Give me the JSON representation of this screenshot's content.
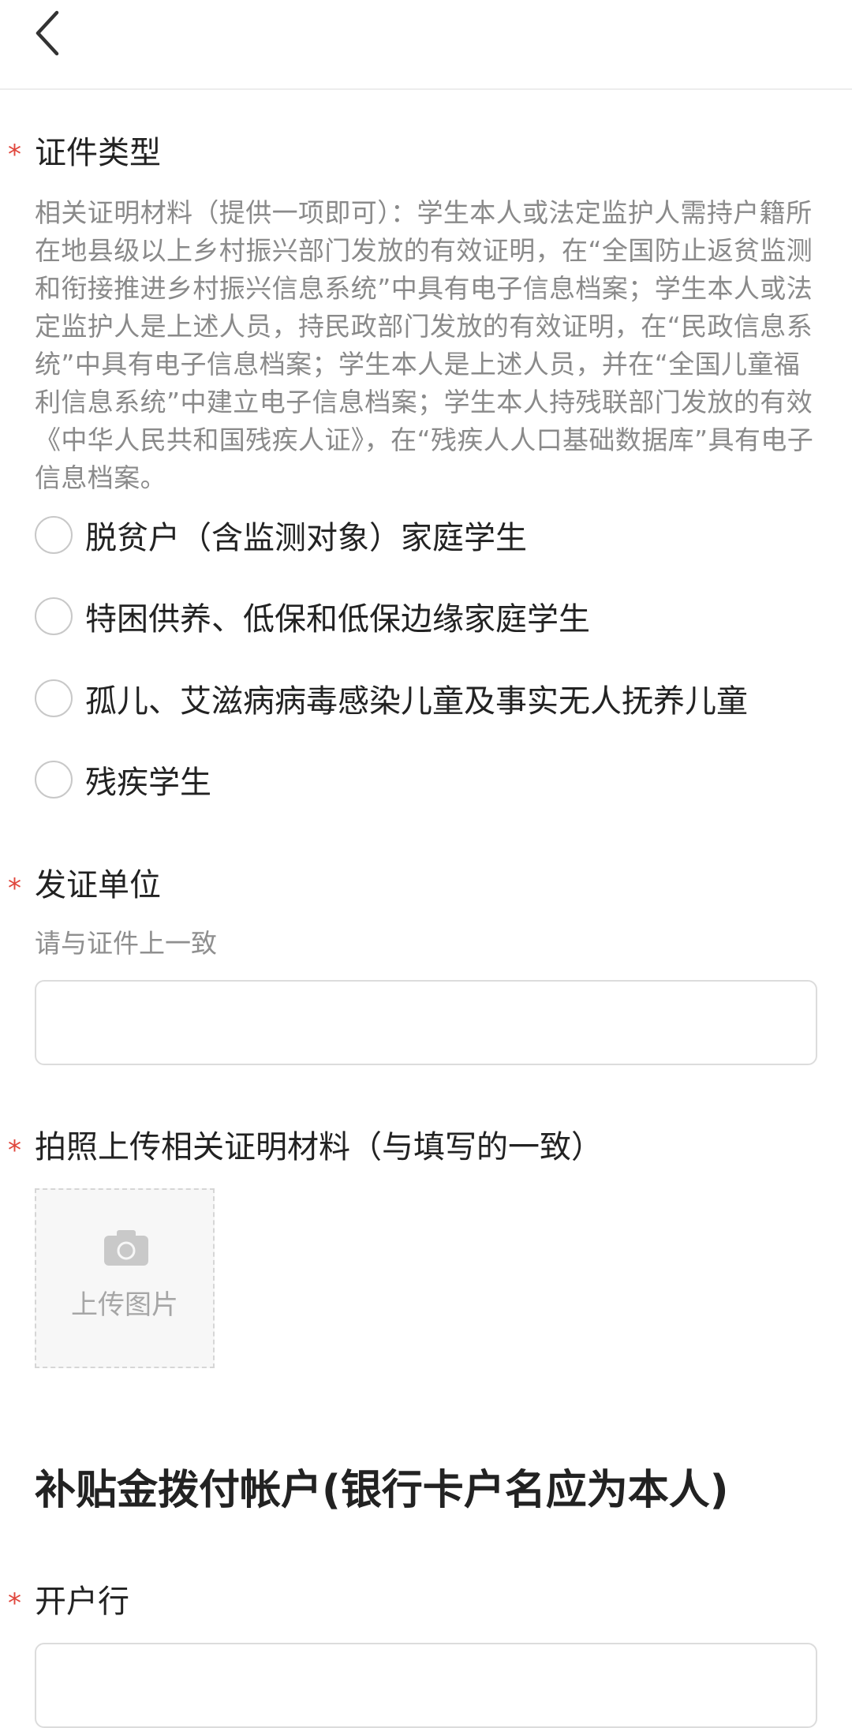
{
  "nav": {
    "back_icon": "chevron-left-icon"
  },
  "cert_type": {
    "required_mark": "*",
    "label": "证件类型",
    "help": "相关证明材料（提供一项即可）：学生本人或法定监护人需持户籍所在地县级以上乡村振兴部门发放的有效证明，在“全国防止返贫监测和衔接推进乡村振兴信息系统”中具有电子信息档案；学生本人或法定监护人是上述人员，持民政部门发放的有效证明，在“民政信息系统”中具有电子信息档案；学生本人是上述人员，并在“全国儿童福利信息系统”中建立电子信息档案；学生本人持残联部门发放的有效《中华人民共和国残疾人证》，在“残疾人人口基础数据库”具有电子信息档案。",
    "options": [
      {
        "label": "脱贫户（含监测对象）家庭学生"
      },
      {
        "label": "特困供养、低保和低保边缘家庭学生"
      },
      {
        "label": "孤儿、艾滋病病毒感染儿童及事实无人抚养儿童"
      },
      {
        "label": "残疾学生"
      }
    ]
  },
  "issuer": {
    "required_mark": "*",
    "label": "发证单位",
    "hint": "请与证件上一致",
    "value": ""
  },
  "photo": {
    "required_mark": "*",
    "label": "拍照上传相关证明材料（与填写的一致）",
    "upload_label": "上传图片",
    "icon": "camera-icon"
  },
  "account_section": {
    "heading": "补贴金拨付帐户(银行卡户名应为本人)"
  },
  "bank": {
    "required_mark": "*",
    "label": "开户行",
    "value": ""
  },
  "colors": {
    "required": "#e0463c",
    "text": "#222222",
    "muted": "#8a8a8a",
    "border": "#dcdcdc"
  }
}
